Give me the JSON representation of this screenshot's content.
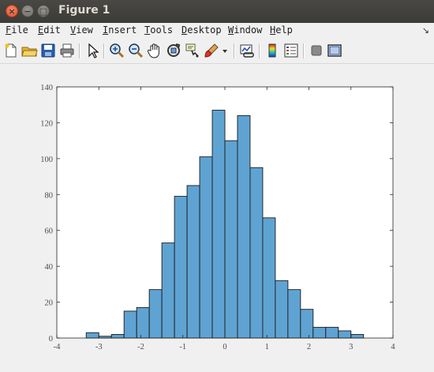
{
  "window": {
    "title": "Figure 1",
    "buttons": {
      "close": "×",
      "minimize": "−",
      "maximize": "□"
    }
  },
  "menu": {
    "items": [
      {
        "first": "F",
        "rest": "ile"
      },
      {
        "first": "E",
        "rest": "dit"
      },
      {
        "first": "V",
        "rest": "iew"
      },
      {
        "first": "I",
        "rest": "nsert"
      },
      {
        "first": "T",
        "rest": "ools"
      },
      {
        "first": "D",
        "rest": "esktop"
      },
      {
        "first": "W",
        "rest": "indow"
      },
      {
        "first": "H",
        "rest": "elp"
      }
    ],
    "dock_glyph": "↘"
  },
  "toolbar": {
    "icons": [
      "new-file-icon",
      "open-folder-icon",
      "save-icon",
      "print-icon",
      "select-arrow-icon",
      "zoom-in-icon",
      "zoom-out-icon",
      "pan-hand-icon",
      "rotate-3d-icon",
      "data-cursor-icon",
      "brush-icon",
      "dropdown-arrow-icon",
      "link-plot-icon",
      "colorbar-icon",
      "legend-icon",
      "hide-plot-tools-icon",
      "show-plot-tools-icon"
    ]
  },
  "colors": {
    "bar_fill": "#5fa3d3",
    "bar_edge": "#1a1a1a",
    "axes_bg": "#ffffff",
    "figure_bg": "#f0f0f0"
  },
  "chart_data": {
    "type": "bar",
    "title": "",
    "xlabel": "",
    "ylabel": "",
    "xlim": [
      -4,
      4
    ],
    "ylim": [
      0,
      140
    ],
    "xticks": [
      "-4",
      "-3",
      "-2",
      "-1",
      "0",
      "1",
      "2",
      "3",
      "4"
    ],
    "yticks": [
      "0",
      "20",
      "40",
      "60",
      "80",
      "100",
      "120",
      "140"
    ],
    "bin_edges": [
      -3.3,
      -3.0,
      -2.7,
      -2.4,
      -2.1,
      -1.8,
      -1.5,
      -1.2,
      -0.9,
      -0.6,
      -0.3,
      0.0,
      0.3,
      0.6,
      0.9,
      1.2,
      1.5,
      1.8,
      2.1,
      2.4,
      2.7,
      3.0,
      3.3
    ],
    "values": [
      3,
      1,
      2,
      15,
      17,
      27,
      53,
      79,
      85,
      101,
      127,
      110,
      124,
      95,
      67,
      32,
      27,
      16,
      6,
      6,
      4,
      2
    ],
    "grid": false,
    "legend": "none"
  }
}
